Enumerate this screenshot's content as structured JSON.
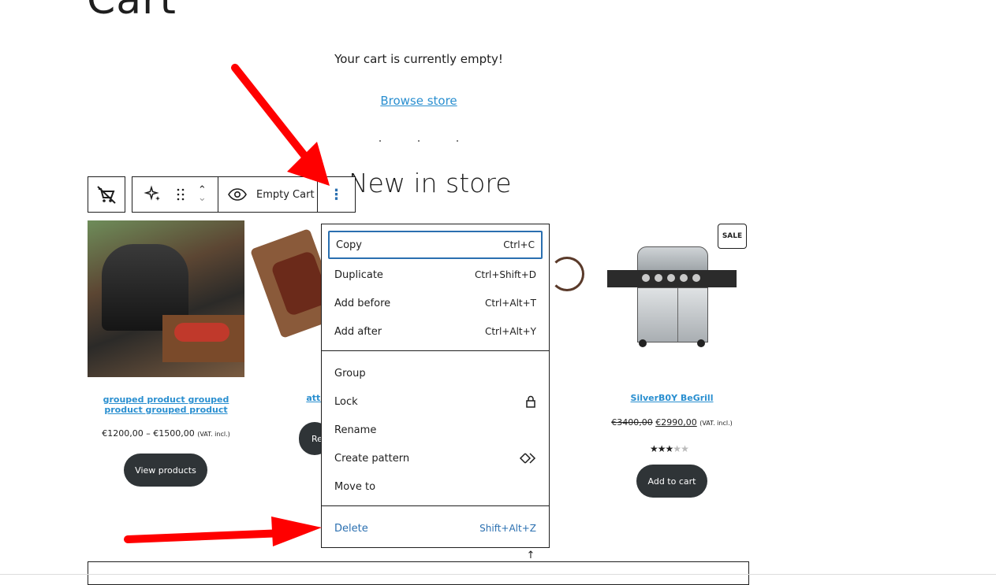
{
  "page": {
    "title": "Cart",
    "empty_message": "Your cart is currently empty!",
    "browse_link": "Browse store",
    "section_title": "New in store"
  },
  "toolbar": {
    "block_label": "Empty Cart"
  },
  "products": [
    {
      "title": "grouped product grouped product grouped product",
      "price": "€1200,00 – €1500,00",
      "tax": "(VAT. incl.)",
      "button": "View products"
    },
    {
      "title": "attr",
      "button": "Re"
    },
    {
      "title": "SilverB0Y BeGrill",
      "price_old": "€3400,00",
      "price_new": "€2990,00",
      "tax": "(VAT. incl.)",
      "badge": "SALE",
      "rating": 3,
      "rating_max": 5,
      "button": "Add to cart"
    }
  ],
  "menu": {
    "items": [
      {
        "label": "Copy",
        "shortcut": "Ctrl+C"
      },
      {
        "label": "Duplicate",
        "shortcut": "Ctrl+Shift+D"
      },
      {
        "label": "Add before",
        "shortcut": "Ctrl+Alt+T"
      },
      {
        "label": "Add after",
        "shortcut": "Ctrl+Alt+Y"
      },
      {
        "label": "Group",
        "shortcut": ""
      },
      {
        "label": "Lock",
        "shortcut": ""
      },
      {
        "label": "Rename",
        "shortcut": ""
      },
      {
        "label": "Create pattern",
        "shortcut": ""
      },
      {
        "label": "Move to",
        "shortcut": ""
      },
      {
        "label": "Delete",
        "shortcut": "Shift+Alt+Z"
      }
    ]
  },
  "colors": {
    "accent": "#2a6fb0",
    "link": "#2a8fd0",
    "arrow": "#ff0000",
    "button_bg": "#2f3437"
  }
}
